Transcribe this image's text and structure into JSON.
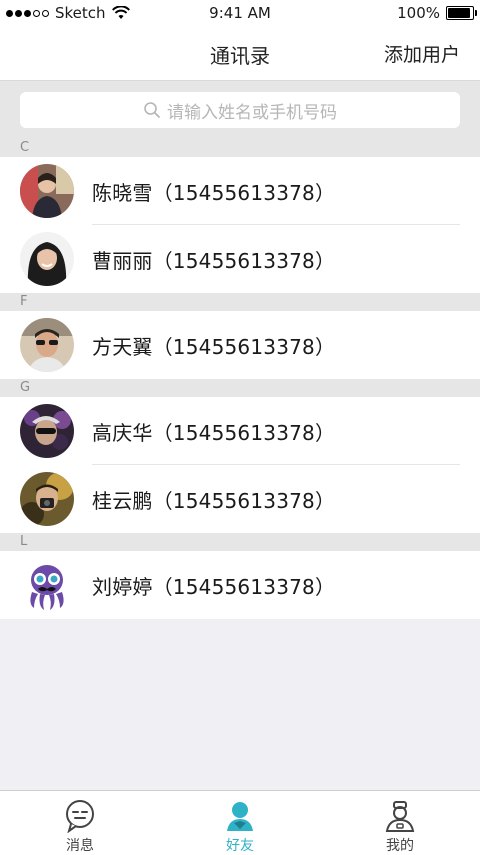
{
  "status_bar": {
    "carrier": "Sketch",
    "time": "9:41 AM",
    "battery": "100%"
  },
  "nav": {
    "title": "通讯录",
    "add_user": "添加用户"
  },
  "search": {
    "placeholder": "请输入姓名或手机号码"
  },
  "sections": [
    {
      "letter": "C",
      "contacts": [
        {
          "name": "陈晓雪（15455613378）"
        },
        {
          "name": "曹丽丽（15455613378）"
        }
      ]
    },
    {
      "letter": "F",
      "contacts": [
        {
          "name": "方天翼（15455613378）"
        }
      ]
    },
    {
      "letter": "G",
      "contacts": [
        {
          "name": "高庆华（15455613378）"
        },
        {
          "name": "桂云鹏（15455613378）"
        }
      ]
    },
    {
      "letter": "L",
      "contacts": [
        {
          "name": "刘婷婷（15455613378）"
        }
      ]
    }
  ],
  "tabs": [
    {
      "label": "消息",
      "icon": "message-icon"
    },
    {
      "label": "好友",
      "icon": "friends-icon",
      "active": true
    },
    {
      "label": "我的",
      "icon": "profile-icon"
    }
  ],
  "colors": {
    "accent": "#2fb2c8",
    "background": "#efeff4",
    "section_header": "#e6e6e6"
  }
}
